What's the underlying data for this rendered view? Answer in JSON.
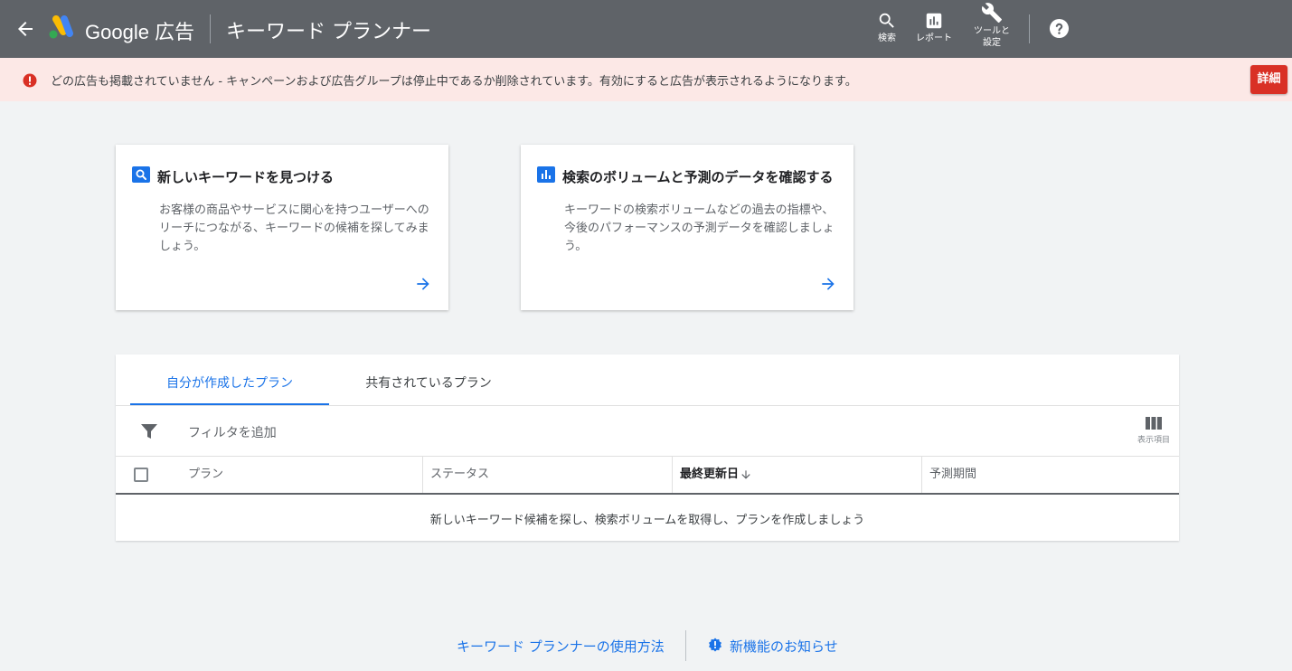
{
  "header": {
    "brand": "Google 広告",
    "title": "キーワード プランナー",
    "tools": {
      "search_label": "検索",
      "report_label": "レポート",
      "tools_label_line1": "ツールと",
      "tools_label_line2": "設定"
    },
    "icons": [
      "back-arrow-icon",
      "google-ads-logo",
      "search-icon",
      "bar-chart-icon",
      "wrench-icon",
      "help-icon"
    ]
  },
  "alert": {
    "message": "どの広告も掲載されていません - キャンペーンおよび広告グループは停止中であるか削除されています。有効にすると広告が表示されるようになります。",
    "button_label": "詳細",
    "color": "#d93025",
    "background": "#fce8e6"
  },
  "cards": [
    {
      "title": "新しいキーワードを見つける",
      "description": "お客様の商品やサービスに関心を持つユーザーへのリーチにつながる、キーワードの候補を探してみましょう。",
      "icon": "search-icon"
    },
    {
      "title": "検索のボリュームと予測のデータを確認する",
      "description": "キーワードの検索ボリュームなどの過去の指標や、今後のパフォーマンスの予測データを確認しましょう。",
      "icon": "bar-chart-icon"
    }
  ],
  "plans": {
    "tabs": [
      {
        "label": "自分が作成したプラン",
        "active": true
      },
      {
        "label": "共有されているプラン",
        "active": false
      }
    ],
    "filter_label": "フィルタを追加",
    "columns_button_label": "表示項目",
    "columns": [
      "プラン",
      "ステータス",
      "最終更新日",
      "予測期間"
    ],
    "sort_column": "最終更新日",
    "empty_message": "新しいキーワード候補を探し、検索ボリュームを取得し、プランを作成しましょう"
  },
  "footer": {
    "howto_label": "キーワード プランナーの使用方法",
    "news_label": "新機能のお知らせ"
  },
  "colors": {
    "accent": "#1a73e8",
    "header_bg": "#5f6368",
    "page_bg": "#f1f3f4"
  }
}
